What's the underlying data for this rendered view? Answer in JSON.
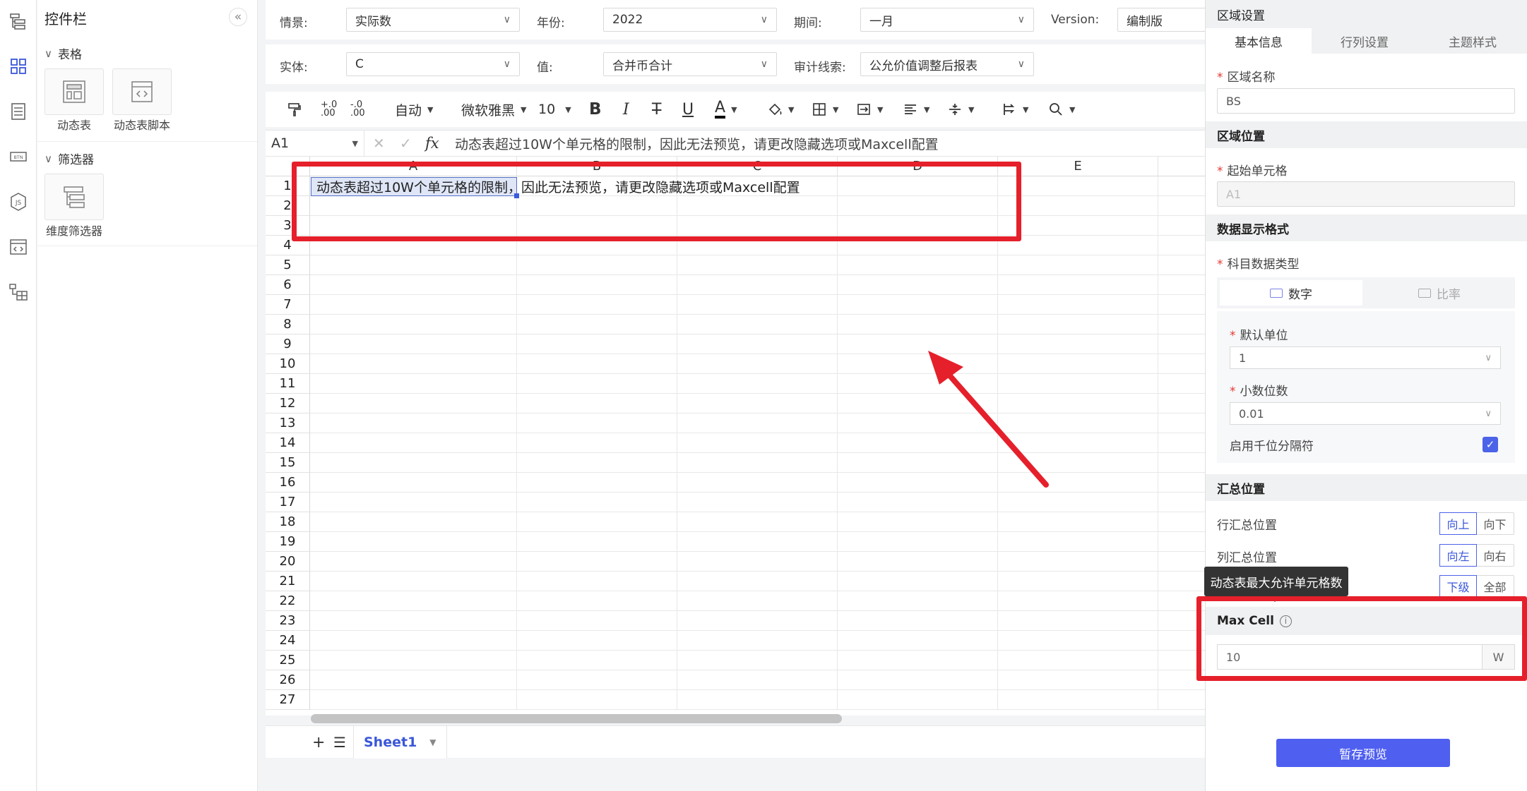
{
  "rail": {
    "icons": [
      "tree-structure-icon",
      "grid-apps-icon",
      "form-list-icon",
      "button-btn-icon",
      "js-script-icon",
      "code-window-icon",
      "table-tree-icon"
    ]
  },
  "widget_panel": {
    "title": "控件栏",
    "collapse_icon": "double-chevron-left-icon",
    "sections": [
      {
        "label": "表格",
        "items": [
          {
            "label": "动态表",
            "icon": "dynamic-table-icon"
          },
          {
            "label": "动态表脚本",
            "icon": "script-code-icon"
          }
        ]
      },
      {
        "label": "筛选器",
        "items": [
          {
            "label": "维度筛选器",
            "icon": "dimension-filter-icon"
          }
        ]
      }
    ]
  },
  "filters": {
    "row1": [
      {
        "label": "情景:",
        "value": "实际数"
      },
      {
        "label": "年份:",
        "value": "2022"
      },
      {
        "label": "期间:",
        "value": "一月"
      },
      {
        "label": "Version:",
        "value": "编制版"
      }
    ],
    "row2": [
      {
        "label": "实体:",
        "value": "C"
      },
      {
        "label": "值:",
        "value": "合并币合计"
      },
      {
        "label": "审计线索:",
        "value": "公允价值调整后报表"
      }
    ]
  },
  "toolbar": {
    "format_painter_icon": "format-painter-icon",
    "dec_increase_label": "+.0\n.00",
    "dec_decrease_label": "-.0\n.00",
    "number_format": "自动",
    "font_family": "微软雅黑",
    "font_size": "10",
    "bold": "B",
    "italic": "I",
    "strike": "T",
    "underline": "U",
    "font_color": "A",
    "font_color_value": "#000000"
  },
  "formula_bar": {
    "cell_ref": "A1",
    "cancel": "✕",
    "confirm": "✓",
    "fx": "fx",
    "formula": "动态表超过10W个单元格的限制，因此无法预览，请更改隐藏选项或Maxcell配置"
  },
  "grid": {
    "columns": [
      "A",
      "B",
      "C",
      "D",
      "E"
    ],
    "rows": [
      "1",
      "2",
      "3",
      "4",
      "5",
      "6",
      "7",
      "8",
      "9",
      "10",
      "11",
      "12",
      "13",
      "14",
      "15",
      "16",
      "17",
      "18",
      "19",
      "20",
      "21",
      "22",
      "23",
      "24",
      "25",
      "26",
      "27"
    ],
    "cell_A1": "动态表超过10W个单元格的限制，因此无法预览，请更改隐藏选项或Maxcell配置"
  },
  "sheet_bar": {
    "add": "+",
    "list": "☰",
    "active_sheet": "Sheet1"
  },
  "props": {
    "header": "区域设置",
    "tabs": [
      "基本信息",
      "行列设置",
      "主题样式"
    ],
    "active_tab": "基本信息",
    "area_name_label": "区域名称",
    "area_name_value": "BS",
    "section_position": "区域位置",
    "start_cell_label": "起始单元格",
    "start_cell_placeholder": "A1",
    "section_format": "数据显示格式",
    "subject_type_label": "科目数据类型",
    "type_number": "数字",
    "type_ratio": "比率",
    "default_unit_label": "默认单位",
    "default_unit_value": "1",
    "decimals_label": "小数位数",
    "decimals_value": "0.01",
    "thousand_sep_label": "启用千位分隔符",
    "thousand_sep_checked": "✓",
    "section_summary": "汇总位置",
    "row_summary_label": "行汇总位置",
    "row_summary_options": [
      "向上",
      "向下"
    ],
    "col_summary_label": "列汇总位置",
    "col_summary_options": [
      "向左",
      "向右"
    ],
    "level_options": [
      "下级",
      "全部"
    ],
    "maxcell_label": "Max Cell",
    "maxcell_info": "i",
    "maxcell_value": "10",
    "maxcell_unit": "W",
    "tooltip": "动态表最大允许单元格数",
    "save_button": "暂存预览"
  },
  "colors": {
    "accent": "#4b63e8",
    "annotation": "#e5202b",
    "selected_cell": "#dfe6f7"
  }
}
